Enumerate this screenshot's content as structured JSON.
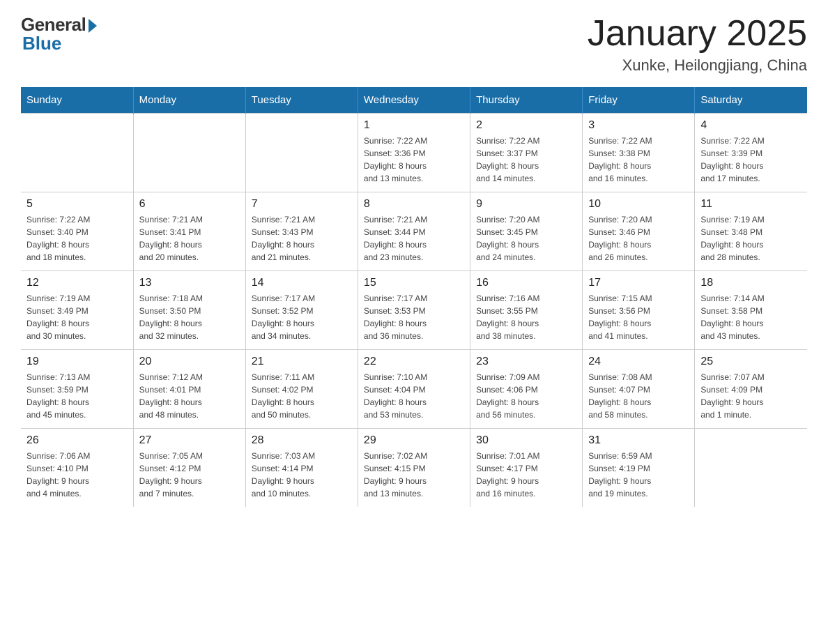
{
  "header": {
    "logo_general": "General",
    "logo_blue": "Blue",
    "title": "January 2025",
    "subtitle": "Xunke, Heilongjiang, China"
  },
  "days_of_week": [
    "Sunday",
    "Monday",
    "Tuesday",
    "Wednesday",
    "Thursday",
    "Friday",
    "Saturday"
  ],
  "weeks": [
    [
      {
        "day": "",
        "info": ""
      },
      {
        "day": "",
        "info": ""
      },
      {
        "day": "",
        "info": ""
      },
      {
        "day": "1",
        "info": "Sunrise: 7:22 AM\nSunset: 3:36 PM\nDaylight: 8 hours\nand 13 minutes."
      },
      {
        "day": "2",
        "info": "Sunrise: 7:22 AM\nSunset: 3:37 PM\nDaylight: 8 hours\nand 14 minutes."
      },
      {
        "day": "3",
        "info": "Sunrise: 7:22 AM\nSunset: 3:38 PM\nDaylight: 8 hours\nand 16 minutes."
      },
      {
        "day": "4",
        "info": "Sunrise: 7:22 AM\nSunset: 3:39 PM\nDaylight: 8 hours\nand 17 minutes."
      }
    ],
    [
      {
        "day": "5",
        "info": "Sunrise: 7:22 AM\nSunset: 3:40 PM\nDaylight: 8 hours\nand 18 minutes."
      },
      {
        "day": "6",
        "info": "Sunrise: 7:21 AM\nSunset: 3:41 PM\nDaylight: 8 hours\nand 20 minutes."
      },
      {
        "day": "7",
        "info": "Sunrise: 7:21 AM\nSunset: 3:43 PM\nDaylight: 8 hours\nand 21 minutes."
      },
      {
        "day": "8",
        "info": "Sunrise: 7:21 AM\nSunset: 3:44 PM\nDaylight: 8 hours\nand 23 minutes."
      },
      {
        "day": "9",
        "info": "Sunrise: 7:20 AM\nSunset: 3:45 PM\nDaylight: 8 hours\nand 24 minutes."
      },
      {
        "day": "10",
        "info": "Sunrise: 7:20 AM\nSunset: 3:46 PM\nDaylight: 8 hours\nand 26 minutes."
      },
      {
        "day": "11",
        "info": "Sunrise: 7:19 AM\nSunset: 3:48 PM\nDaylight: 8 hours\nand 28 minutes."
      }
    ],
    [
      {
        "day": "12",
        "info": "Sunrise: 7:19 AM\nSunset: 3:49 PM\nDaylight: 8 hours\nand 30 minutes."
      },
      {
        "day": "13",
        "info": "Sunrise: 7:18 AM\nSunset: 3:50 PM\nDaylight: 8 hours\nand 32 minutes."
      },
      {
        "day": "14",
        "info": "Sunrise: 7:17 AM\nSunset: 3:52 PM\nDaylight: 8 hours\nand 34 minutes."
      },
      {
        "day": "15",
        "info": "Sunrise: 7:17 AM\nSunset: 3:53 PM\nDaylight: 8 hours\nand 36 minutes."
      },
      {
        "day": "16",
        "info": "Sunrise: 7:16 AM\nSunset: 3:55 PM\nDaylight: 8 hours\nand 38 minutes."
      },
      {
        "day": "17",
        "info": "Sunrise: 7:15 AM\nSunset: 3:56 PM\nDaylight: 8 hours\nand 41 minutes."
      },
      {
        "day": "18",
        "info": "Sunrise: 7:14 AM\nSunset: 3:58 PM\nDaylight: 8 hours\nand 43 minutes."
      }
    ],
    [
      {
        "day": "19",
        "info": "Sunrise: 7:13 AM\nSunset: 3:59 PM\nDaylight: 8 hours\nand 45 minutes."
      },
      {
        "day": "20",
        "info": "Sunrise: 7:12 AM\nSunset: 4:01 PM\nDaylight: 8 hours\nand 48 minutes."
      },
      {
        "day": "21",
        "info": "Sunrise: 7:11 AM\nSunset: 4:02 PM\nDaylight: 8 hours\nand 50 minutes."
      },
      {
        "day": "22",
        "info": "Sunrise: 7:10 AM\nSunset: 4:04 PM\nDaylight: 8 hours\nand 53 minutes."
      },
      {
        "day": "23",
        "info": "Sunrise: 7:09 AM\nSunset: 4:06 PM\nDaylight: 8 hours\nand 56 minutes."
      },
      {
        "day": "24",
        "info": "Sunrise: 7:08 AM\nSunset: 4:07 PM\nDaylight: 8 hours\nand 58 minutes."
      },
      {
        "day": "25",
        "info": "Sunrise: 7:07 AM\nSunset: 4:09 PM\nDaylight: 9 hours\nand 1 minute."
      }
    ],
    [
      {
        "day": "26",
        "info": "Sunrise: 7:06 AM\nSunset: 4:10 PM\nDaylight: 9 hours\nand 4 minutes."
      },
      {
        "day": "27",
        "info": "Sunrise: 7:05 AM\nSunset: 4:12 PM\nDaylight: 9 hours\nand 7 minutes."
      },
      {
        "day": "28",
        "info": "Sunrise: 7:03 AM\nSunset: 4:14 PM\nDaylight: 9 hours\nand 10 minutes."
      },
      {
        "day": "29",
        "info": "Sunrise: 7:02 AM\nSunset: 4:15 PM\nDaylight: 9 hours\nand 13 minutes."
      },
      {
        "day": "30",
        "info": "Sunrise: 7:01 AM\nSunset: 4:17 PM\nDaylight: 9 hours\nand 16 minutes."
      },
      {
        "day": "31",
        "info": "Sunrise: 6:59 AM\nSunset: 4:19 PM\nDaylight: 9 hours\nand 19 minutes."
      },
      {
        "day": "",
        "info": ""
      }
    ]
  ]
}
